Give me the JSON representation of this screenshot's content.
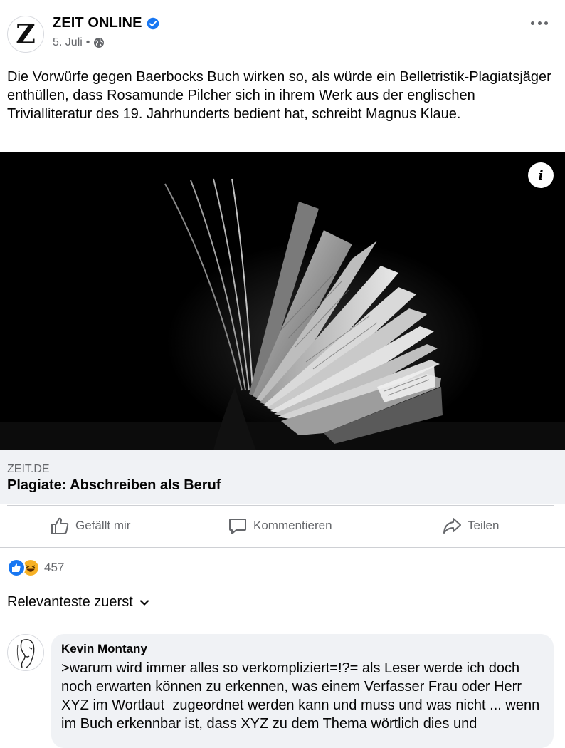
{
  "post": {
    "author": "ZEIT ONLINE",
    "avatar_letter": "Z",
    "date": "5. Juli",
    "meta_separator": "•",
    "text": "Die Vorwürfe gegen Baerbocks Buch wirken so, als würde ein Belletristik-Plagiatsjäger enthüllen, dass Rosamunde Pilcher sich in ihrem Werk aus der englischen Trivialliteratur des 19. Jahrhunderts bedient hat, schreibt Magnus Klaue."
  },
  "icons": {
    "verified": "verified-badge-icon",
    "audience": "globe-icon",
    "more": "more-options-icon",
    "info": "info-icon",
    "like": "thumbs-up-icon",
    "comment": "comment-bubble-icon",
    "share": "share-arrow-icon",
    "sort": "chevron-down-icon"
  },
  "link_preview": {
    "info_glyph": "i",
    "domain": "ZEIT.DE",
    "title": "Plagiate: Abschreiben als Beruf"
  },
  "actions": {
    "like": "Gefällt mir",
    "comment": "Kommentieren",
    "share": "Teilen"
  },
  "reactions": {
    "types": [
      "like",
      "haha"
    ],
    "count": "457"
  },
  "comments": {
    "sort_label": "Relevanteste zuerst",
    "items": [
      {
        "author": "Kevin Montany",
        "text": ">warum wird immer alles so verkompliziert=!?= als Leser werde ich doch noch erwarten können zu erkennen, was einem Verfasser Frau oder Herr XYZ im Wortlaut  zugeordnet werden kann und muss und was nicht ... wenn im Buch erkennbar ist, dass XYZ zu dem Thema wörtlich dies und"
      }
    ]
  },
  "colors": {
    "facebook_blue": "#1877f2",
    "secondary_text": "#65676b",
    "card_background": "#f0f2f5",
    "haha_yellow": "#f7b125"
  }
}
